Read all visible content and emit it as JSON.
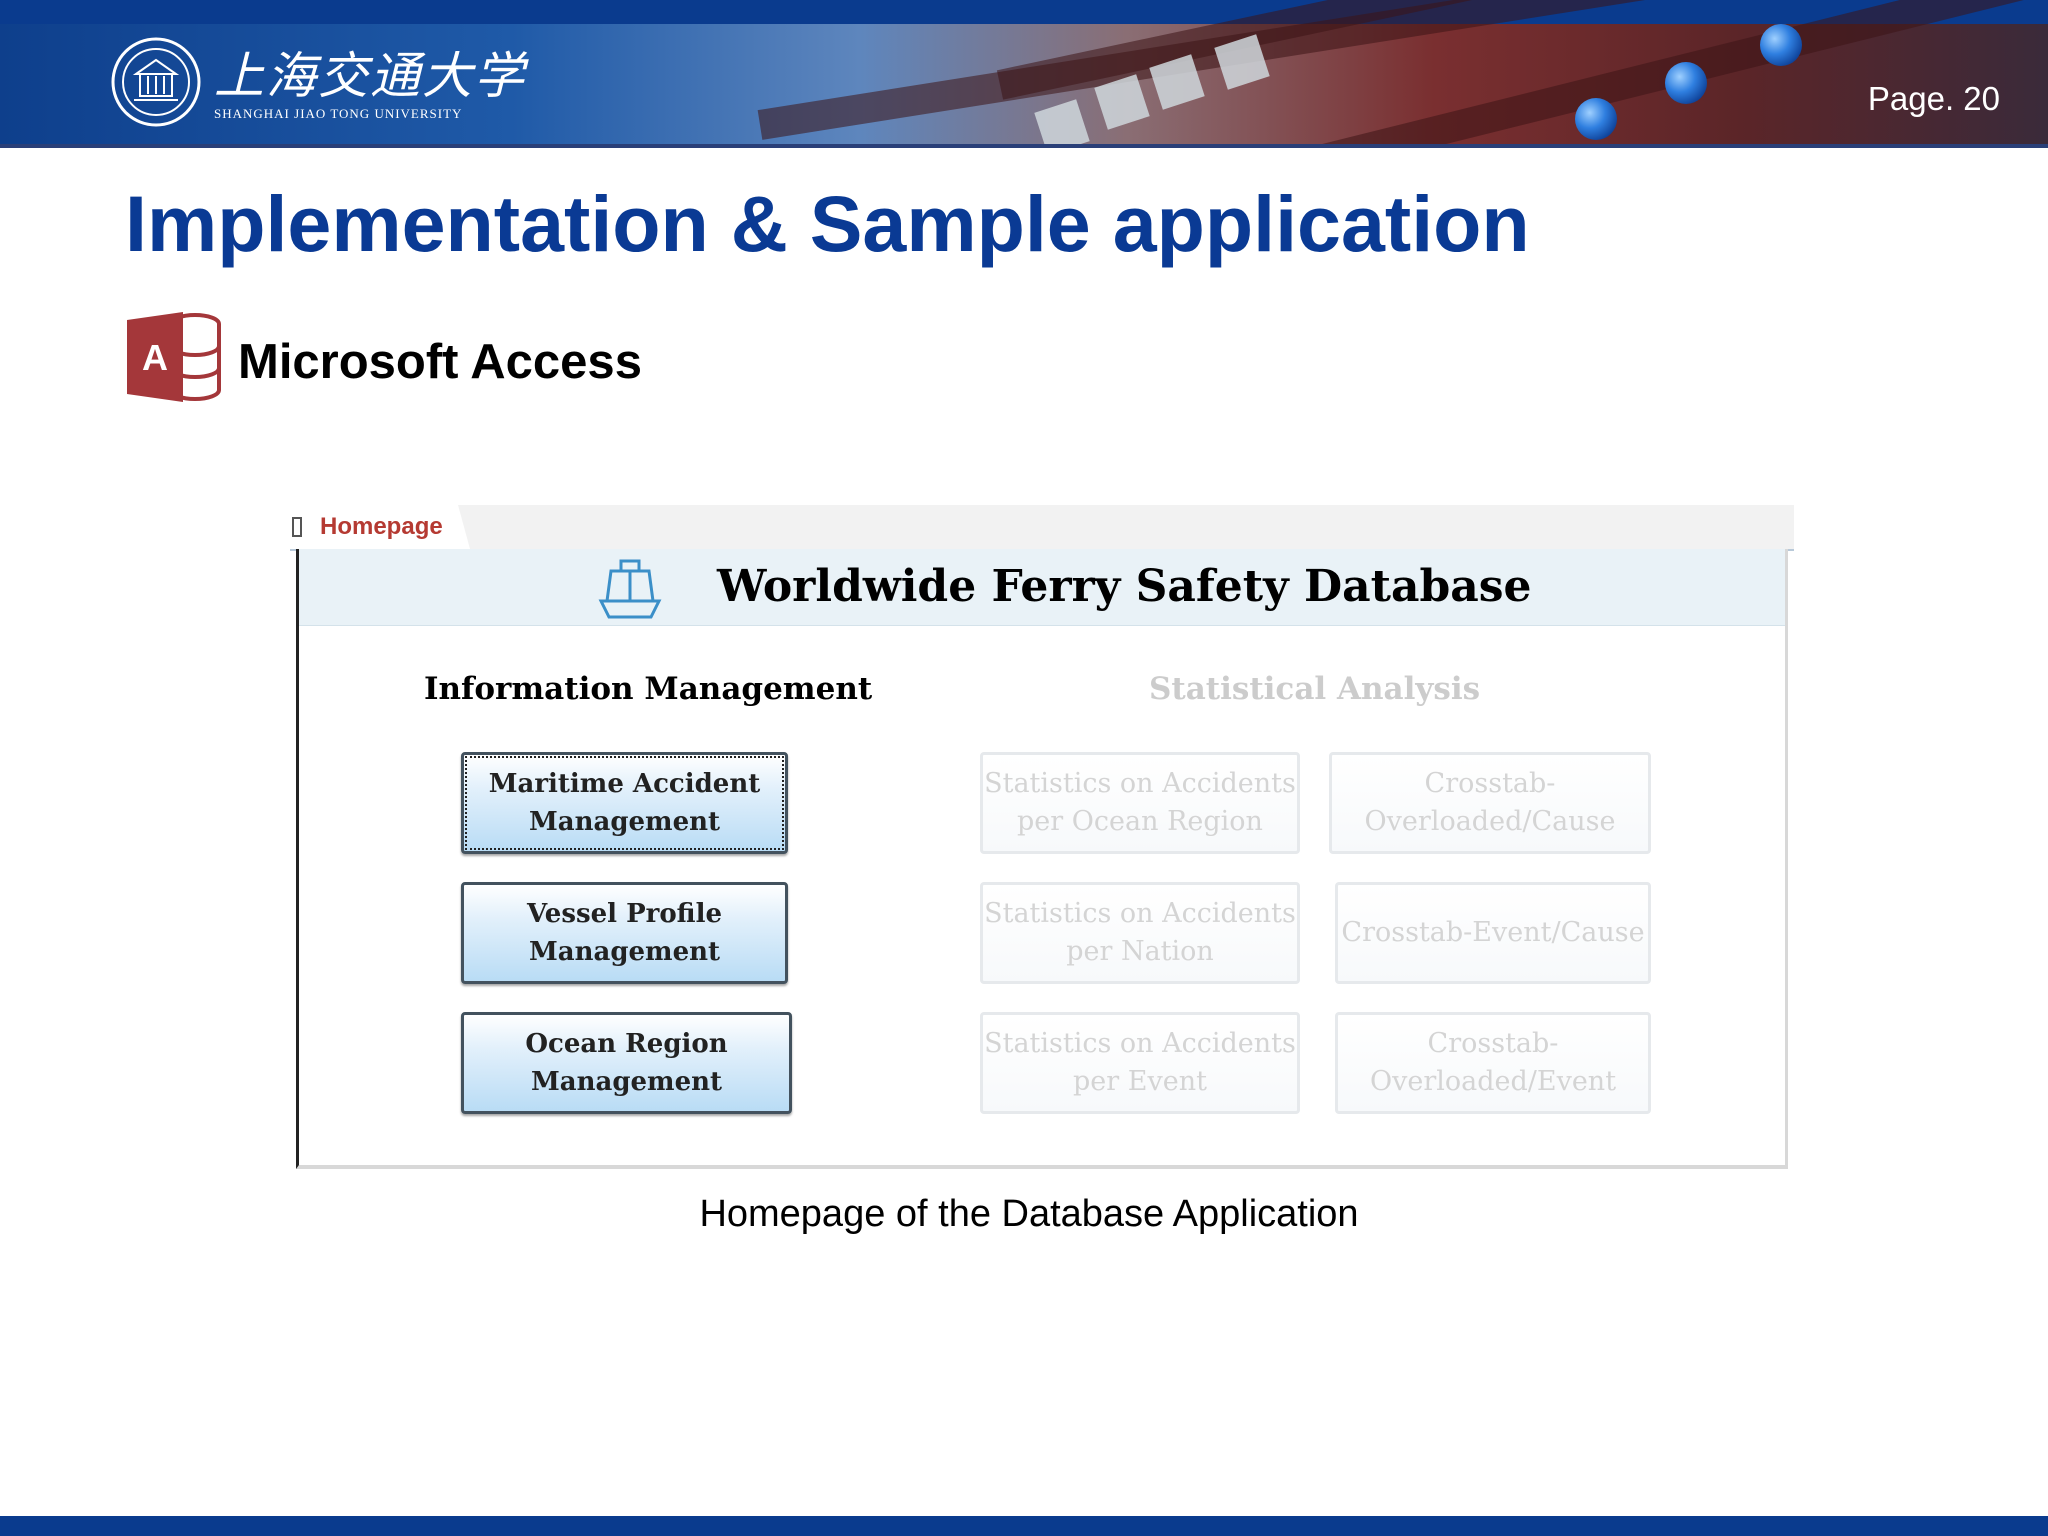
{
  "header": {
    "university_cn": "上海交通大学",
    "university_en": "SHANGHAI JIAO TONG UNIVERSITY",
    "page_number": "Page. 20",
    "colors": {
      "brand_blue": "#0a3b8e",
      "banner_red": "#7a2f30"
    },
    "logo_icon": "university-seal-icon"
  },
  "slide": {
    "title": "Implementation & Sample application",
    "app_label": "Microsoft Access",
    "app_icon": "microsoft-access-icon",
    "title_color": "#0a3a94",
    "caption": "Homepage of the Database Application"
  },
  "form": {
    "tab_label": "Homepage",
    "title": "Worldwide Ferry Safety Database",
    "title_icon": "ship-icon",
    "info_section": "Information Management",
    "stat_section": "Statistical Analysis",
    "info_buttons": [
      {
        "line1": "Maritime Accident",
        "line2": "Management"
      },
      {
        "line1": "Vessel Profile",
        "line2": "Management"
      },
      {
        "line1": "Ocean Region",
        "line2": "Management"
      }
    ],
    "stat_buttons": [
      {
        "line1": "Statistics on Accidents",
        "line2": "per Ocean Region"
      },
      {
        "line1": "Statistics on Accidents",
        "line2": "per Nation"
      },
      {
        "line1": "Statistics on Accidents",
        "line2": "per Event"
      }
    ],
    "crosstab_buttons": [
      {
        "line1": "Crosstab-",
        "line2": "Overloaded/Cause"
      },
      {
        "line1": "Crosstab-Event/Cause",
        "line2": ""
      },
      {
        "line1": "Crosstab-",
        "line2": "Overloaded/Event"
      }
    ],
    "disabled_text_color": "#d4d4d4"
  }
}
